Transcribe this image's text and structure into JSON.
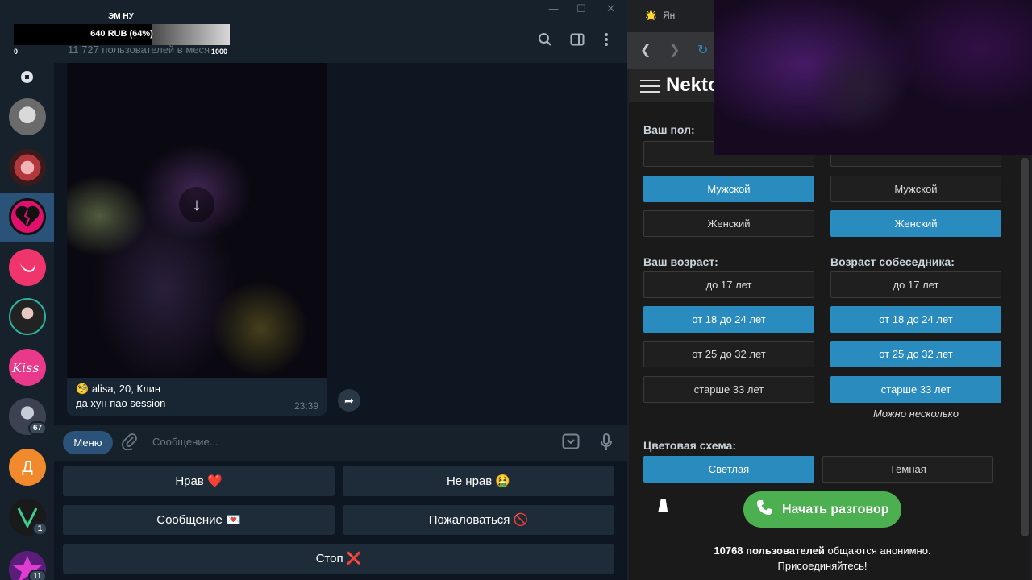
{
  "overlay": {
    "streamer_name": "ЭМ НУ",
    "donation_text": "640 RUB (64%)",
    "donation_min": "0",
    "donation_max": "1000",
    "donation_progress": 0.64
  },
  "telegram": {
    "subscribers": "11 727 пользователей в меся",
    "window_controls": [
      "—",
      "☐",
      "✕"
    ],
    "rail_badges": {
      "chat7": "67",
      "chat9": "1",
      "chat10": "11"
    },
    "chat_letter": "Д",
    "message": {
      "line1": "alisa, 20, Клин",
      "line2": "да хун пао session",
      "time": "23:39"
    },
    "composer": {
      "menu_label": "Меню",
      "placeholder": "Сообщение..."
    },
    "keyboard": {
      "like": "Нрав ❤️",
      "dislike": "Не нрав 🤮",
      "message": "Сообщение 💌",
      "report": "Пожаловаться 🚫",
      "stop": "Стоп ❌"
    }
  },
  "browser": {
    "tab_label": "Ян",
    "brand": "Nekto",
    "your_gender_label": "Ваш пол:",
    "gender_mine": [
      "Мужской",
      "Женский"
    ],
    "gender_partner": [
      "Мужской",
      "Женский"
    ],
    "your_age_label": "Ваш возраст:",
    "partner_age_label": "Возраст собеседника:",
    "ages": [
      "до 17 лет",
      "от 18 до 24 лет",
      "от 25 до 32 лет",
      "старше 33 лет"
    ],
    "multi_note": "Можно несколько",
    "scheme_label": "Цветовая схема:",
    "scheme_light": "Светлая",
    "scheme_dark": "Тёмная",
    "start_label": "Начать разговор",
    "users_count": "10768 пользователей",
    "users_suffix": " общаются анонимно.",
    "join_text": "Присоединяйтесь!",
    "selected": {
      "gender_mine": "Мужской",
      "gender_partner": "Женский",
      "age_mine": "от 18 до 24 лет",
      "age_partner": [
        "от 18 до 24 лет",
        "от 25 до 32 лет",
        "старше 33 лет"
      ],
      "scheme": "Светлая"
    },
    "accent_color": "#2a8bbf",
    "start_color": "#4caf50"
  }
}
